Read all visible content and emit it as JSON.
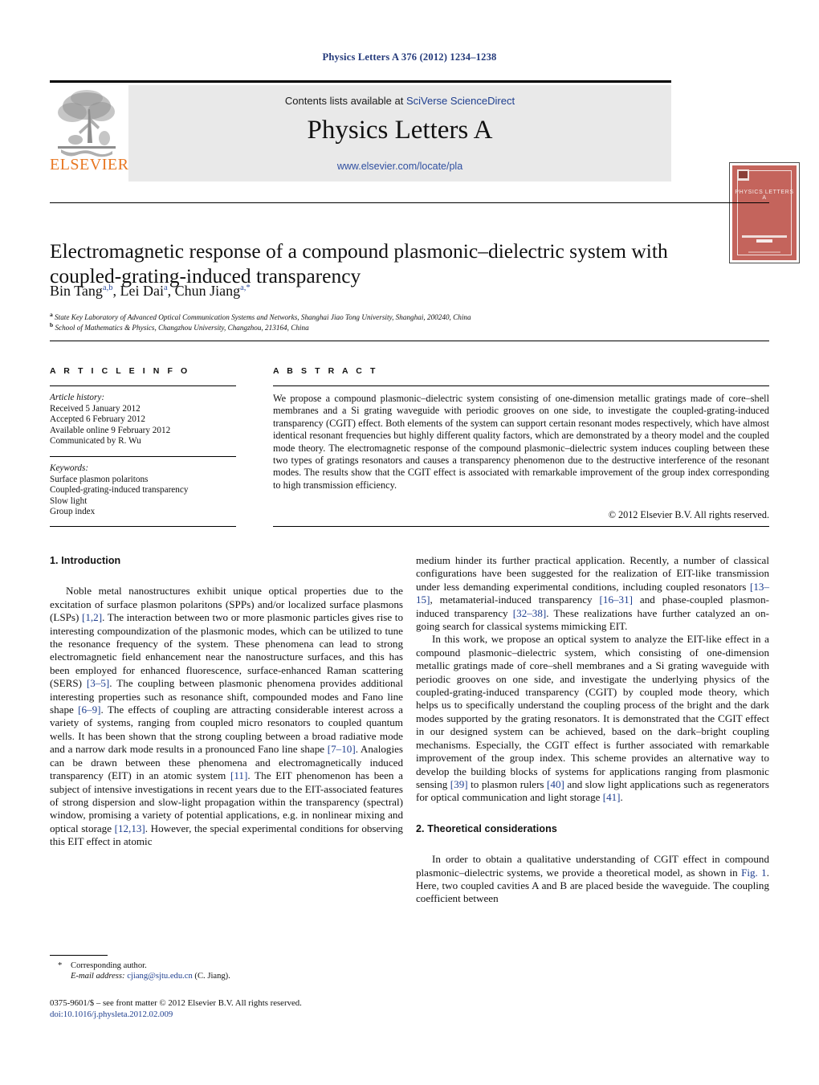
{
  "running_head": "Physics Letters A 376 (2012) 1234–1238",
  "masthead": {
    "contents_prefix": "Contents lists available at ",
    "contents_link": "SciVerse ScienceDirect",
    "journal_title": "Physics Letters A",
    "journal_url": "www.elsevier.com/locate/pla",
    "publisher_logo_text": "ELSEVIER",
    "cover_title": "PHYSICS LETTERS A",
    "link_color": "#2f4fa0",
    "cover_color": "#c4645c",
    "elsevier_orange": "#e87722"
  },
  "article": {
    "title": "Electromagnetic response of a compound plasmonic–dielectric system with coupled-grating-induced transparency",
    "authors": [
      {
        "name": "Bin Tang",
        "sup": "a,b"
      },
      {
        "name": "Lei Dai",
        "sup": "a"
      },
      {
        "name": "Chun Jiang",
        "sup": "a,*"
      }
    ],
    "affiliations": [
      {
        "mark": "a",
        "text": "State Key Laboratory of Advanced Optical Communication Systems and Networks, Shanghai Jiao Tong University, Shanghai, 200240, China"
      },
      {
        "mark": "b",
        "text": "School of Mathematics & Physics, Changzhou University, Changzhou, 213164, China"
      }
    ]
  },
  "info": {
    "heading": "A R T I C L E    I N F O",
    "history_label": "Article history:",
    "history": [
      "Received 5 January 2012",
      "Accepted 6 February 2012",
      "Available online 9 February 2012",
      "Communicated by R. Wu"
    ],
    "keywords_label": "Keywords:",
    "keywords": [
      "Surface plasmon polaritons",
      "Coupled-grating-induced transparency",
      "Slow light",
      "Group index"
    ]
  },
  "abstract": {
    "heading": "A B S T R A C T",
    "text": "We propose a compound plasmonic–dielectric system consisting of one-dimension metallic gratings made of core–shell membranes and a Si grating waveguide with periodic grooves on one side, to investigate the coupled-grating-induced transparency (CGIT) effect. Both elements of the system can support certain resonant modes respectively, which have almost identical resonant frequencies but highly different quality factors, which are demonstrated by a theory model and the coupled mode theory. The electromagnetic response of the compound plasmonic–dielectric system induces coupling between these two types of gratings resonators and causes a transparency phenomenon due to the destructive interference of the resonant modes. The results show that the CGIT effect is associated with remarkable improvement of the group index corresponding to high transmission efficiency.",
    "copyright": "© 2012 Elsevier B.V. All rights reserved."
  },
  "body": {
    "section1_heading": "1. Introduction",
    "section1_p1_a": "Noble metal nanostructures exhibit unique optical properties due to the excitation of surface plasmon polaritons (SPPs) and/or localized surface plasmons (LSPs) ",
    "section1_p1_r1": "[1,2]",
    "section1_p1_b": ". The interaction between two or more plasmonic particles gives rise to interesting compoundization of the plasmonic modes, which can be utilized to tune the resonance frequency of the system. These phenomena can lead to strong electromagnetic field enhancement near the nanostructure surfaces, and this has been employed for enhanced fluorescence, surface-enhanced Raman scattering (SERS) ",
    "section1_p1_r2": "[3–5]",
    "section1_p1_c": ". The coupling between plasmonic phenomena provides additional interesting properties such as resonance shift, compounded modes and Fano line shape ",
    "section1_p1_r3": "[6–9]",
    "section1_p1_d": ". The effects of coupling are attracting considerable interest across a variety of systems, ranging from coupled micro resonators to coupled quantum wells. It has been shown that the strong coupling between a broad radiative mode and a narrow dark mode results in a pronounced Fano line shape ",
    "section1_p1_r4": "[7–10]",
    "section1_p1_e": ". Analogies can be drawn between these phenomena and electromagnetically induced transparency (EIT) in an atomic system ",
    "section1_p1_r5": "[11]",
    "section1_p1_f": ". The EIT phenomenon has been a subject of intensive investigations in recent years due to the EIT-associated features of strong dispersion and slow-light propagation within the transparency (spectral) window, promising a variety of potential applications, e.g. in nonlinear mixing and optical storage ",
    "section1_p1_r6": "[12,13]",
    "section1_p1_g": ". However, the special experimental conditions for observing this EIT effect in atomic",
    "right_p1_a": "medium hinder its further practical application. Recently, a number of classical configurations have been suggested for the realization of EIT-like transmission under less demanding experimental conditions, including coupled resonators ",
    "right_p1_r1": "[13–15]",
    "right_p1_b": ", metamaterial-induced transparency ",
    "right_p1_r2": "[16–31]",
    "right_p1_c": " and phase-coupled plasmon-induced transparency ",
    "right_p1_r3": "[32–38]",
    "right_p1_d": ". These realizations have further catalyzed an on-going search for classical systems mimicking EIT.",
    "right_p2_a": "In this work, we propose an optical system to analyze the EIT-like effect in a compound plasmonic–dielectric system, which consisting of one-dimension metallic gratings made of core–shell membranes and a Si grating waveguide with periodic grooves on one side, and investigate the underlying physics of the coupled-grating-induced transparency (CGIT) by coupled mode theory, which helps us to specifically understand the coupling process of the bright and the dark modes supported by the grating resonators. It is demonstrated that the CGIT effect in our designed system can be achieved, based on the dark–bright coupling mechanisms. Especially, the CGIT effect is further associated with remarkable improvement of the group index. This scheme provides an alternative way to develop the building blocks of systems for applications ranging from plasmonic sensing ",
    "right_p2_r1": "[39]",
    "right_p2_b": " to plasmon rulers ",
    "right_p2_r2": "[40]",
    "right_p2_c": " and slow light applications such as regenerators for optical communication and light storage ",
    "right_p2_r3": "[41]",
    "right_p2_d": ".",
    "section2_heading": "2. Theoretical considerations",
    "section2_p1_a": "In order to obtain a qualitative understanding of CGIT effect in compound plasmonic–dielectric systems, we provide a theoretical model, as shown in ",
    "section2_p1_fig": "Fig. 1",
    "section2_p1_b": ". Here, two coupled cavities A and B are placed beside the waveguide. The coupling coefficient between"
  },
  "footnotes": {
    "star": "*",
    "corresponding": "Corresponding author.",
    "email_label": "E-mail address:",
    "email": "cjiang@sjtu.edu.cn",
    "email_suffix": " (C. Jiang).",
    "imprint": "0375-9601/$ – see front matter © 2012 Elsevier B.V. All rights reserved.",
    "doi": "doi:10.1016/j.physleta.2012.02.009"
  }
}
